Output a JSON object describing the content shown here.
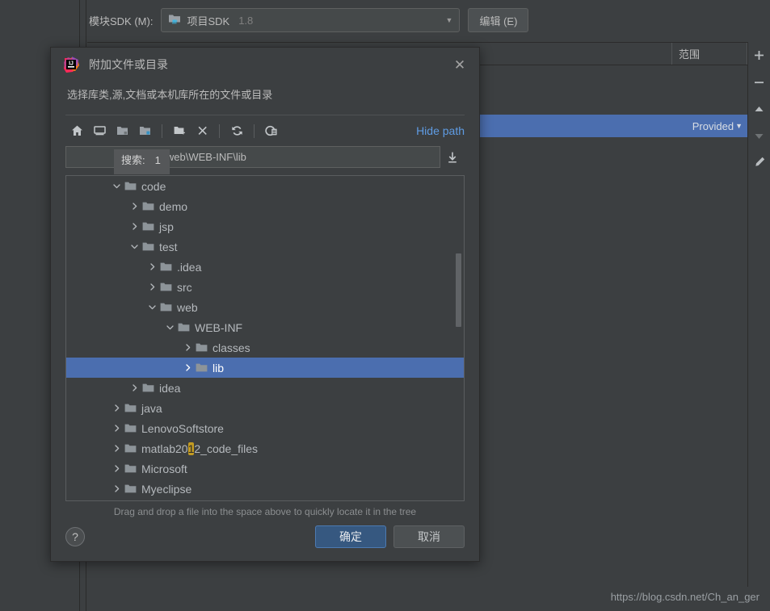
{
  "background": {
    "sdk_label": "模块SDK (M):",
    "sdk_value": "项目SDK",
    "sdk_version": "1.8",
    "edit_button": "编辑 (E)",
    "table_headers": {
      "main": "",
      "scope": "范围"
    },
    "selected_row_scope": "Provided",
    "watermark": "https://blog.csdn.net/Ch_an_ger",
    "right_toolbar": [
      "add-icon",
      "remove-icon",
      "move-up-icon",
      "move-down-icon",
      "edit-pencil-icon"
    ]
  },
  "dialog": {
    "title": "附加文件或目录",
    "subtitle": "选择库类,源,文档或本机库所在的文件或目录",
    "close_label": "✕",
    "toolbar": [
      {
        "name": "home-icon",
        "tip": "Home"
      },
      {
        "name": "desktop-icon",
        "tip": "Desktop"
      },
      {
        "name": "project-folder-icon",
        "tip": "Project"
      },
      {
        "name": "module-folder-icon",
        "tip": "Module"
      },
      {
        "name": "new-folder-icon",
        "tip": "New Folder"
      },
      {
        "name": "delete-icon",
        "tip": "Delete"
      },
      {
        "name": "refresh-icon",
        "tip": "Refresh"
      },
      {
        "name": "show-hidden-icon",
        "tip": "Show Hidden Files"
      }
    ],
    "hide_path_label": "Hide path",
    "path_value": "ode\\test\\web\\WEB-INF\\lib",
    "search_tip_label": "搜索:",
    "search_tip_count": "1",
    "drag_hint": "Drag and drop a file into the space above to quickly locate it in the tree",
    "help_label": "?",
    "ok_label": "确定",
    "cancel_label": "取消",
    "tree": [
      {
        "label": "code",
        "level": 0,
        "state": "expanded",
        "selected": false
      },
      {
        "label": "demo",
        "level": 1,
        "state": "collapsed",
        "selected": false
      },
      {
        "label": "jsp",
        "level": 1,
        "state": "collapsed",
        "selected": false
      },
      {
        "label": "test",
        "level": 1,
        "state": "expanded",
        "selected": false
      },
      {
        "label": ".idea",
        "level": 2,
        "state": "collapsed",
        "selected": false
      },
      {
        "label": "src",
        "level": 2,
        "state": "collapsed",
        "selected": false
      },
      {
        "label": "web",
        "level": 2,
        "state": "expanded",
        "selected": false
      },
      {
        "label": "WEB-INF",
        "level": 3,
        "state": "expanded",
        "selected": false
      },
      {
        "label": "classes",
        "level": 4,
        "state": "collapsed",
        "selected": false
      },
      {
        "label": "lib",
        "level": 4,
        "state": "collapsed",
        "selected": true
      },
      {
        "label": "idea",
        "level": 1,
        "state": "collapsed",
        "selected": false
      },
      {
        "label": "java",
        "level": 0,
        "state": "collapsed",
        "selected": false
      },
      {
        "label": "LenovoSoftstore",
        "level": 0,
        "state": "collapsed",
        "selected": false
      },
      {
        "label": "matlab2012_code_files",
        "level": 0,
        "state": "collapsed",
        "selected": false,
        "highlight": "1"
      },
      {
        "label": "Microsoft",
        "level": 0,
        "state": "collapsed",
        "selected": false
      },
      {
        "label": "Myeclipse",
        "level": 0,
        "state": "collapsed",
        "selected": false
      }
    ]
  },
  "colors": {
    "bg": "#3c3f41",
    "selection": "#4b6eaf",
    "link": "#5f9ce4",
    "primary_button": "#365880",
    "highlight": "#c39b22"
  }
}
